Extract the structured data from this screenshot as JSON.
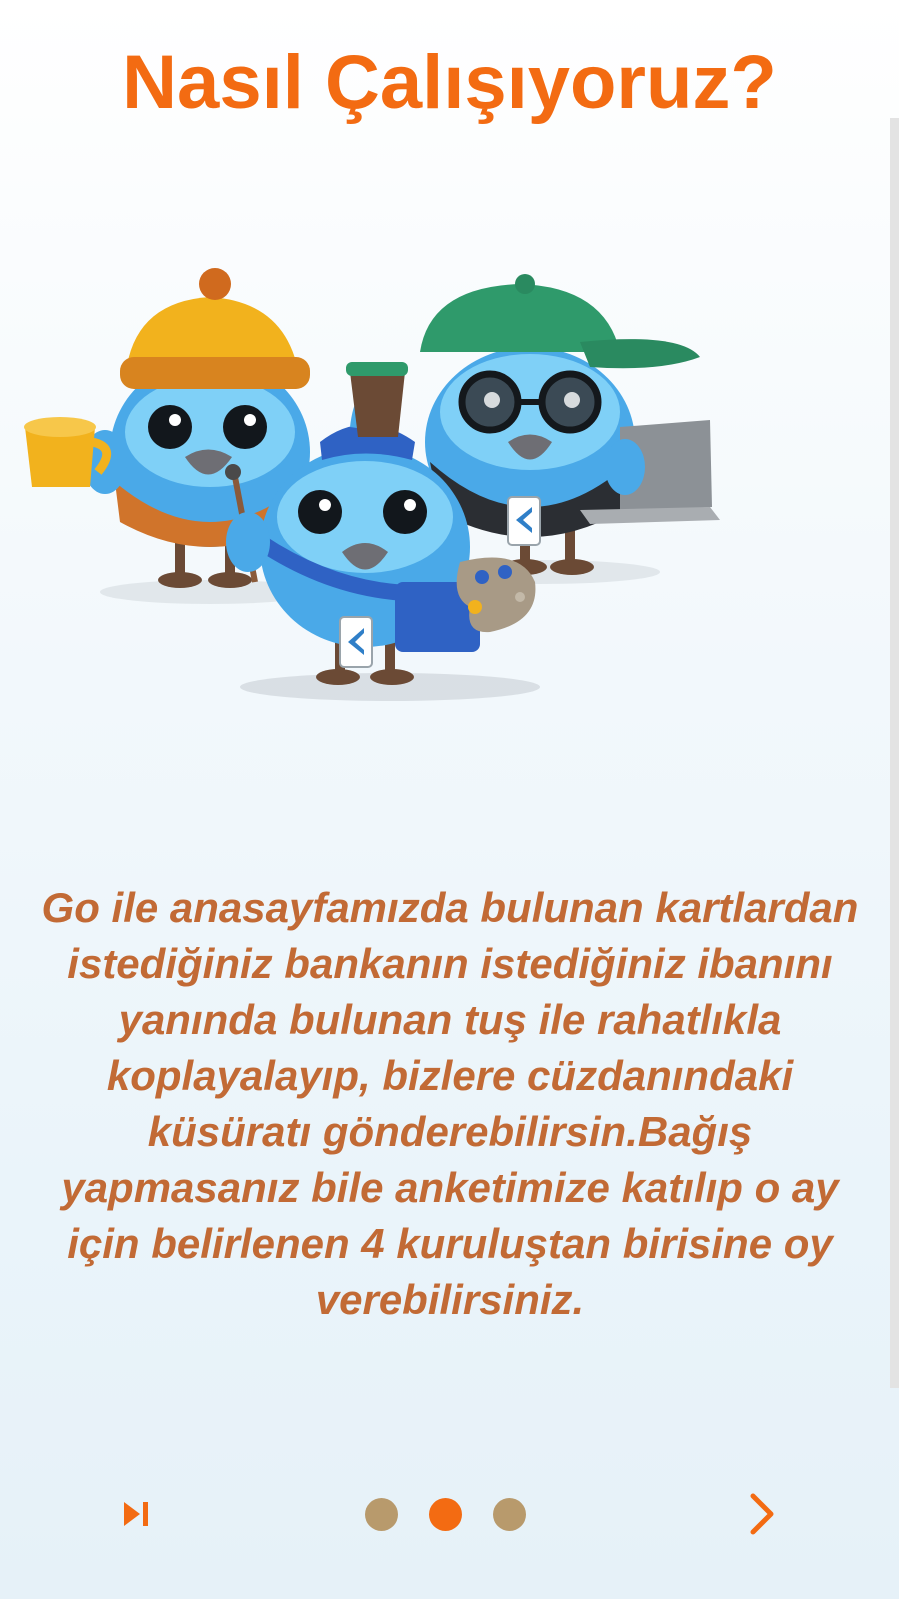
{
  "page": {
    "title": "Nasıl Çalışıyoruz?",
    "description": "Go ile anasayfamızda bulunan kartlardan istediğiniz bankanın istediğiniz ibanını yanında bulunan tuş ile rahatlıkla koplayalayıp, bizlere cüzdanındaki küsüratı gönderebilirsin.Bağış yapmasanız bile anketimize katılıp o ay için belirlenen 4 kuruluştan birisine oy verebilirsiniz."
  },
  "illustration": {
    "subject": "three blue bird mascots with hats, mug, laptop and paint palette"
  },
  "navigation": {
    "skip_icon": "skip-next-icon",
    "next_icon": "chevron-right-icon",
    "page_count": 3,
    "active_index": 1
  },
  "colors": {
    "accent": "#f36b12",
    "body_text": "#c26a35",
    "dot_inactive": "#b89a6c",
    "dot_active": "#f36b12"
  }
}
